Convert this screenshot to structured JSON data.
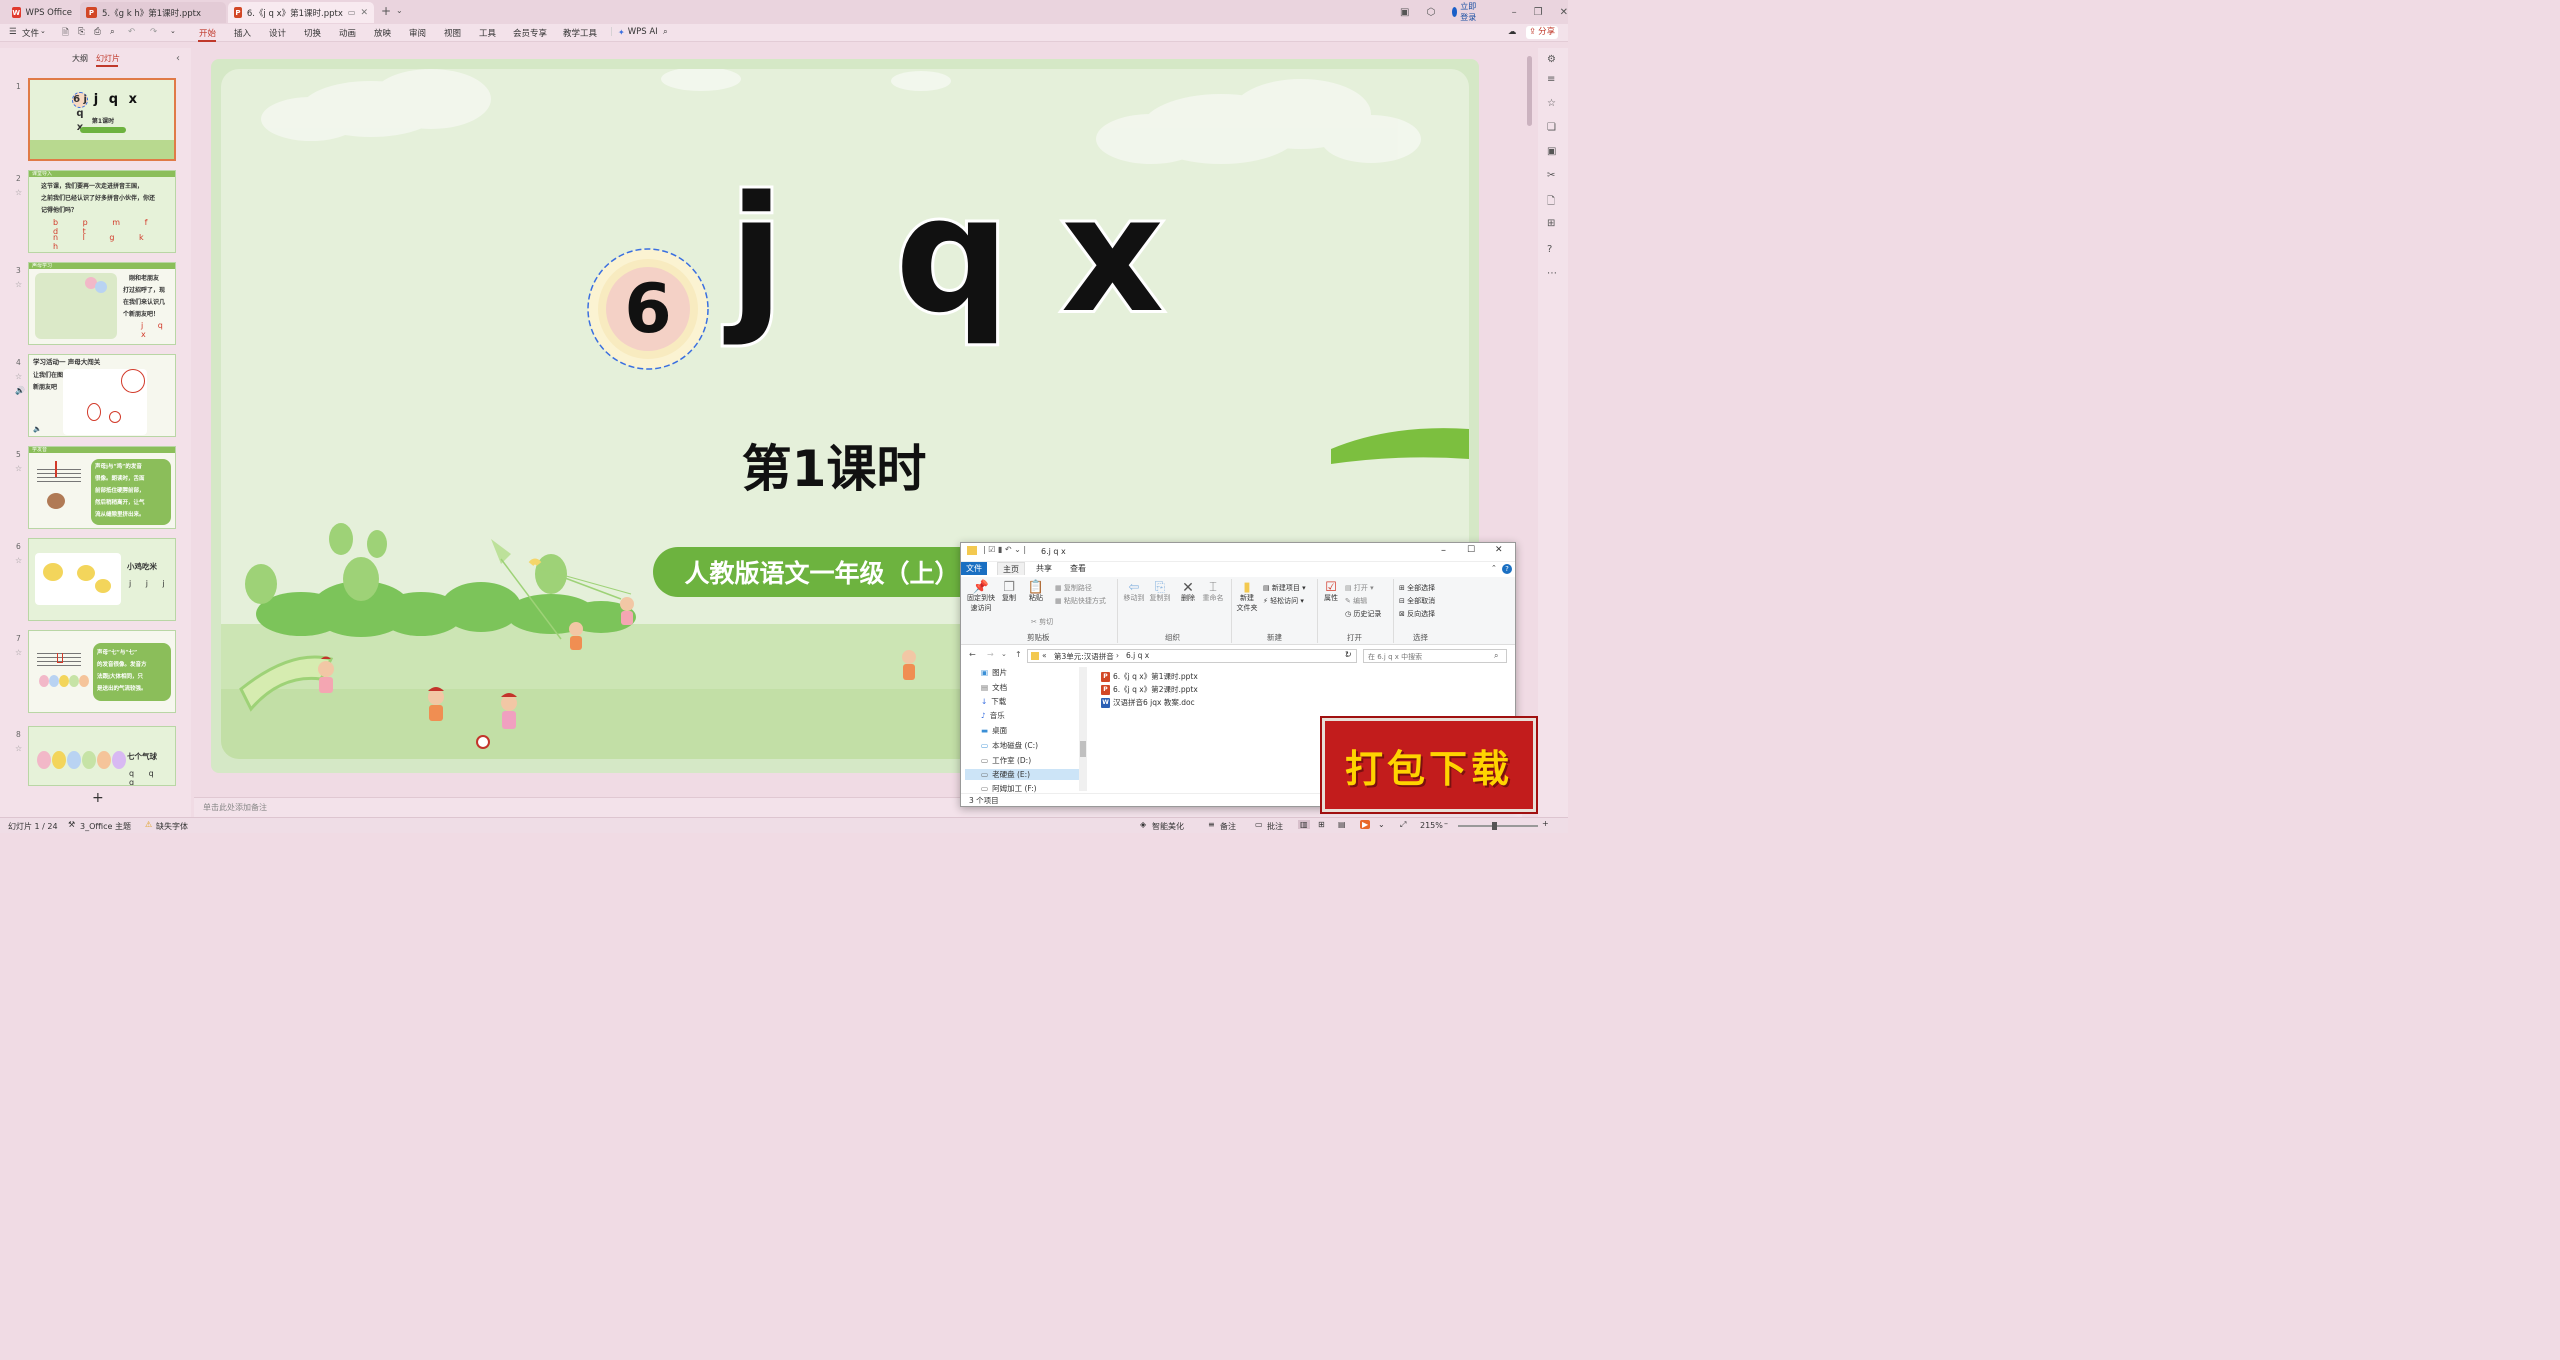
{
  "tabs": [
    {
      "label": "WPS Office",
      "icon": "wps-logo-icon"
    },
    {
      "label": "5.《g k h》第1课时.pptx",
      "icon": "pptx-file-icon"
    },
    {
      "label": "6.《j q x》第1课时.pptx",
      "icon": "pptx-file-icon",
      "active": true
    }
  ],
  "titlebar": {
    "login": "立即登录"
  },
  "ribbon": {
    "file": "文件",
    "menus": [
      "开始",
      "插入",
      "设计",
      "切换",
      "动画",
      "放映",
      "审阅",
      "视图",
      "工具",
      "会员专享",
      "教学工具"
    ],
    "ai": "WPS AI",
    "share": "分享"
  },
  "leftpane": {
    "tab_outline": "大纲",
    "tab_slides": "幻灯片",
    "add": "+",
    "thumbs": [
      {
        "num": "1",
        "title": "6 j q x",
        "subtitle": "第1课时"
      },
      {
        "num": "2",
        "bar": "课堂导入",
        "text": [
          "这节课，我们要再一次走进拼音王国，",
          "之前我们已经认识了好多拼音小伙伴，你还",
          "记得他们吗？"
        ],
        "pinyin1": "b p m f d t",
        "pinyin2": "n l g k h"
      },
      {
        "num": "3",
        "bar": "声母学习",
        "text": [
          "刚和老朋友",
          "打过招呼了，现",
          "在我们来认识几",
          "个新朋友吧！"
        ],
        "pinyin": "j q x"
      },
      {
        "num": "4",
        "bar": "学习活动一",
        "title": "学习活动一   声母大闯关",
        "text": [
          "让我们在图中找找",
          "新朋友吧"
        ]
      },
      {
        "num": "5",
        "bar": "学发音",
        "text": [
          "声母j与“鸡”的发音",
          "很像。朗读时，舌面",
          "前部抵住硬腭前部，",
          "然后稍稍离开，让气",
          "流从缝隙里挤出来。"
        ]
      },
      {
        "num": "6",
        "title": "小鸡吃米",
        "pinyin": "j j j"
      },
      {
        "num": "7",
        "text": [
          "声母“七”与“七”",
          "的发音很像。发音方",
          "法跟j大体相同，只",
          "是送出的气流较强。"
        ]
      },
      {
        "num": "8",
        "title": "七个气球",
        "pinyin": "q q q"
      }
    ]
  },
  "slide": {
    "badge_number": "6",
    "letters": [
      "j",
      "q",
      "x"
    ],
    "lesson": "第1课时",
    "subtitle": "人教版语文一年级（上）"
  },
  "notes_placeholder": "单击此处添加备注",
  "status": {
    "slide_pos": "幻灯片 1 / 24",
    "theme": "3_Office 主题",
    "missing_font": "缺失字体",
    "smart": "智能美化",
    "notes": "备注",
    "comments": "批注",
    "zoom": "215%"
  },
  "explorer": {
    "title": "6.j q x",
    "ribbon_tabs": [
      "文件",
      "主页",
      "共享",
      "查看"
    ],
    "buttons": {
      "pin": "固定到快\n速访问",
      "copy": "复制",
      "paste": "粘贴",
      "copy_path": "复制路径",
      "paste_shortcut": "粘贴快捷方式",
      "cut": "剪切",
      "move_to": "移动到",
      "copy_to": "复制到",
      "delete": "删除",
      "rename": "重命名",
      "new_folder": "新建\n文件夹",
      "new_item": "新建项目",
      "easy_access": "轻松访问",
      "properties": "属性",
      "open": "打开",
      "edit": "编辑",
      "history": "历史记录",
      "select_all": "全部选择",
      "select_none": "全部取消",
      "invert": "反向选择"
    },
    "groups": [
      "剪贴板",
      "组织",
      "新建",
      "打开",
      "选择"
    ],
    "path": [
      "«",
      "第3单元:汉语拼音",
      "›",
      "6.j q x"
    ],
    "search_placeholder": "在 6.j q x 中搜索",
    "nav": [
      "图片",
      "文档",
      "下载",
      "音乐",
      "桌面",
      "本地磁盘 (C:)",
      "工作室 (D:)",
      "老硬盘 (E:)",
      "阿姆加工 (F:)"
    ],
    "files": [
      {
        "name": "6.《j q x》第1课时.pptx",
        "type": "pptx"
      },
      {
        "name": "6.《j q x》第2课时.pptx",
        "type": "pptx"
      },
      {
        "name": "汉语拼音6 jqx 教案.doc",
        "type": "doc"
      }
    ],
    "count": "3 个项目"
  },
  "download_badge": "打包下载",
  "colors": {
    "accent": "#c0392b",
    "slide_green": "#6db33f",
    "badge_red": "#c21c1c",
    "badge_text": "#ffd400"
  }
}
